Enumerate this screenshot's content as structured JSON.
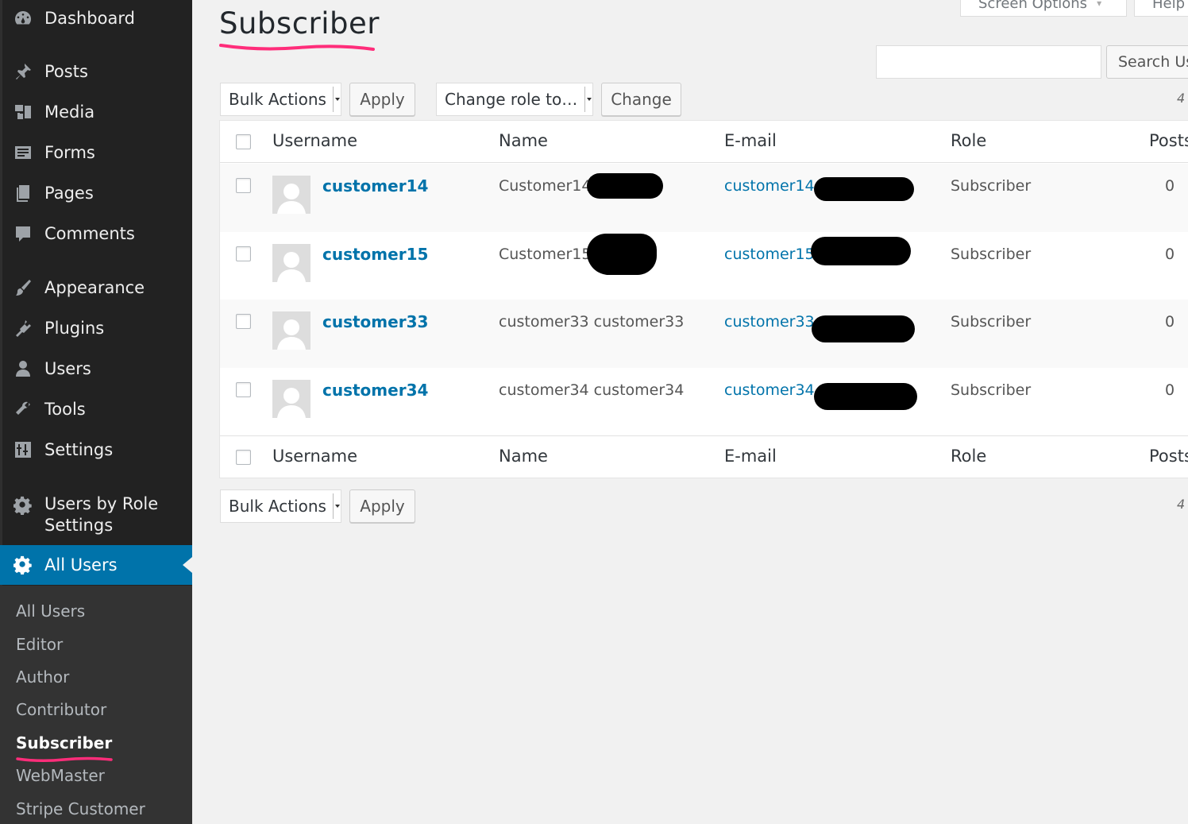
{
  "sidebar": {
    "menu": [
      {
        "label": "Dashboard",
        "icon": "dashboard-icon"
      },
      {
        "label": "Posts",
        "icon": "pushpin-icon"
      },
      {
        "label": "Media",
        "icon": "media-icon"
      },
      {
        "label": "Forms",
        "icon": "forms-icon"
      },
      {
        "label": "Pages",
        "icon": "pages-icon"
      },
      {
        "label": "Comments",
        "icon": "comment-icon"
      },
      {
        "label": "Appearance",
        "icon": "paintbrush-icon"
      },
      {
        "label": "Plugins",
        "icon": "plugin-icon"
      },
      {
        "label": "Users",
        "icon": "users-icon"
      },
      {
        "label": "Tools",
        "icon": "wrench-icon"
      },
      {
        "label": "Settings",
        "icon": "settings-icon"
      },
      {
        "label": "Users by Role Settings",
        "icon": "gear-icon"
      },
      {
        "label": "All Users",
        "icon": "gear-icon"
      }
    ],
    "submenu": [
      "All Users",
      "Editor",
      "Author",
      "Contributor",
      "Subscriber",
      "WebMaster",
      "Stripe Customer"
    ],
    "current_submenu": "Subscriber"
  },
  "header": {
    "title": "Subscriber",
    "screen_options": "Screen Options",
    "help": "Help"
  },
  "search": {
    "value": "",
    "button": "Search Users"
  },
  "toolbar": {
    "bulk_actions": "Bulk Actions",
    "apply": "Apply",
    "change_role": "Change role to…",
    "change": "Change",
    "count": "4"
  },
  "table": {
    "columns": [
      "Username",
      "Name",
      "E-mail",
      "Role",
      "Posts"
    ],
    "rows": [
      {
        "username": "customer14",
        "name": "Customer14",
        "email": "customer14",
        "role": "Subscriber",
        "posts": "0"
      },
      {
        "username": "customer15",
        "name": "Customer15",
        "email": "customer15",
        "role": "Subscriber",
        "posts": "0"
      },
      {
        "username": "customer33",
        "name": "customer33 customer33",
        "email": "customer33",
        "role": "Subscriber",
        "posts": "0"
      },
      {
        "username": "customer34",
        "name": "customer34 customer34",
        "email": "customer34",
        "role": "Subscriber",
        "posts": "0"
      }
    ]
  },
  "bottom_toolbar": {
    "bulk_actions": "Bulk Actions",
    "apply": "Apply",
    "count": "4"
  },
  "colors": {
    "accent": "#0073aa",
    "sidebar": "#222222",
    "highlight_underline": "#ff2d7a"
  }
}
